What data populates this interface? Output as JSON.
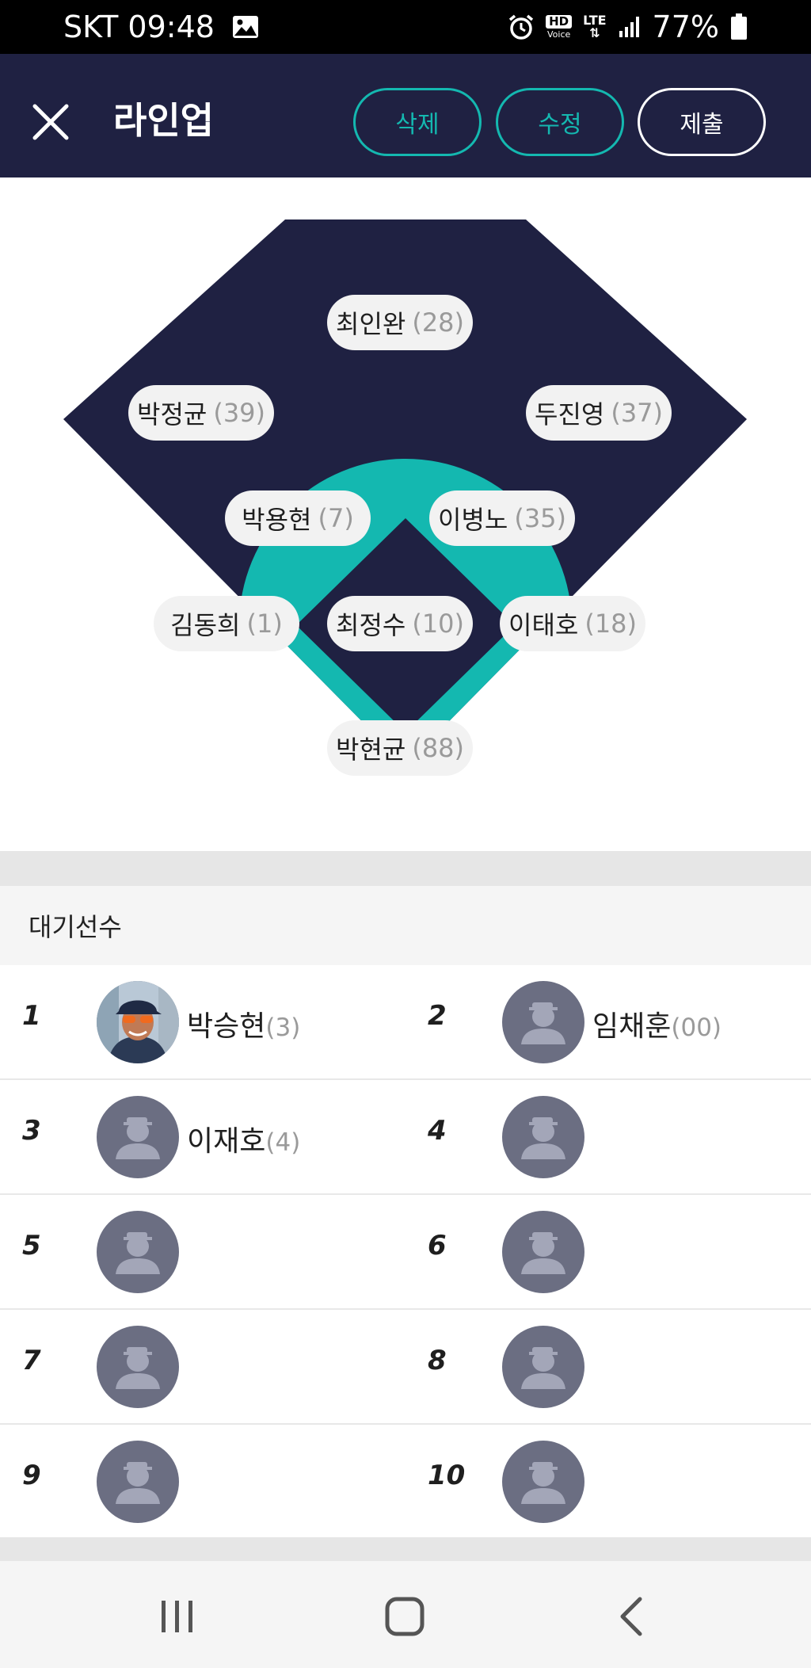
{
  "status_bar": {
    "carrier": "SKT",
    "time": "09:48",
    "hd_label": "HD",
    "voice_label": "Voice",
    "lte_label": "LTE",
    "battery_percent": "77%"
  },
  "header": {
    "title": "라인업",
    "delete_label": "삭제",
    "edit_label": "수정",
    "submit_label": "제출"
  },
  "colors": {
    "navy": "#1f2142",
    "teal": "#14b8b0"
  },
  "positions": [
    {
      "role": "center-field",
      "name": "최인완",
      "number": "(28)"
    },
    {
      "role": "left-field",
      "name": "박정균",
      "number": "(39)"
    },
    {
      "role": "right-field",
      "name": "두진영",
      "number": "(37)"
    },
    {
      "role": "shortstop",
      "name": "박용현",
      "number": "(7)"
    },
    {
      "role": "second-base",
      "name": "이병노",
      "number": "(35)"
    },
    {
      "role": "third-base",
      "name": "김동희",
      "number": "(1)"
    },
    {
      "role": "pitcher",
      "name": "최정수",
      "number": "(10)"
    },
    {
      "role": "first-base",
      "name": "이태호",
      "number": "(18)"
    },
    {
      "role": "catcher",
      "name": "박현균",
      "number": "(88)"
    }
  ],
  "bench": {
    "title": "대기선수",
    "slots": [
      {
        "order": "1",
        "name": "박승현",
        "number": "(3)",
        "has_photo": true
      },
      {
        "order": "2",
        "name": "임채훈",
        "number": "(00)",
        "has_photo": false
      },
      {
        "order": "3",
        "name": "이재호",
        "number": "(4)",
        "has_photo": false
      },
      {
        "order": "4",
        "name": "",
        "number": "",
        "has_photo": false
      },
      {
        "order": "5",
        "name": "",
        "number": "",
        "has_photo": false
      },
      {
        "order": "6",
        "name": "",
        "number": "",
        "has_photo": false
      },
      {
        "order": "7",
        "name": "",
        "number": "",
        "has_photo": false
      },
      {
        "order": "8",
        "name": "",
        "number": "",
        "has_photo": false
      },
      {
        "order": "9",
        "name": "",
        "number": "",
        "has_photo": false
      },
      {
        "order": "10",
        "name": "",
        "number": "",
        "has_photo": false
      }
    ]
  },
  "nav_bar": {
    "icons": [
      "recents-icon",
      "home-icon",
      "back-icon"
    ]
  }
}
